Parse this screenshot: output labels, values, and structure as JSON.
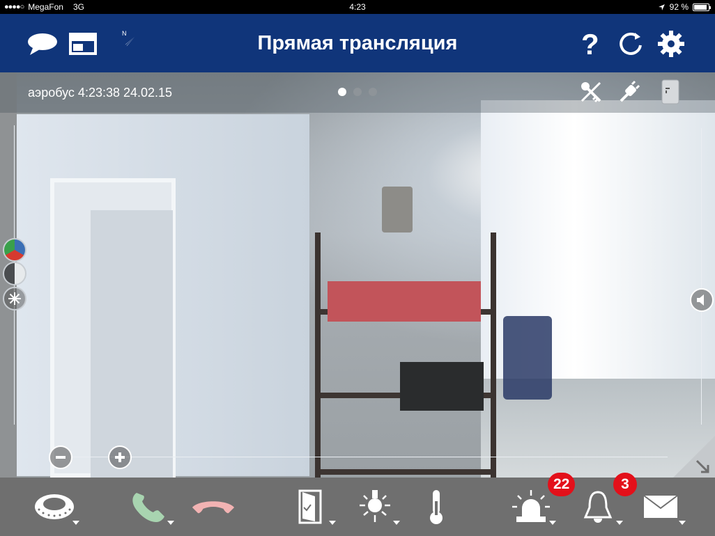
{
  "status": {
    "carrier": "MegaFon",
    "network": "3G",
    "signal_dots": "●●●●○",
    "time": "4:23",
    "battery": "92 %",
    "battery_level": 0.92
  },
  "header": {
    "title": "Прямая трансляция"
  },
  "camera": {
    "label": "аэробус 4:23:38 24.02.15",
    "pages_total": 3,
    "page_active": 1
  },
  "badges": {
    "alarm": "22",
    "bell": "3"
  },
  "colors": {
    "navbar": "#10357a",
    "toolbar": "#6f6f6f",
    "badge": "#e3101a",
    "phone_accept": "#a8d4b0",
    "phone_decline": "#f2b3b3"
  }
}
